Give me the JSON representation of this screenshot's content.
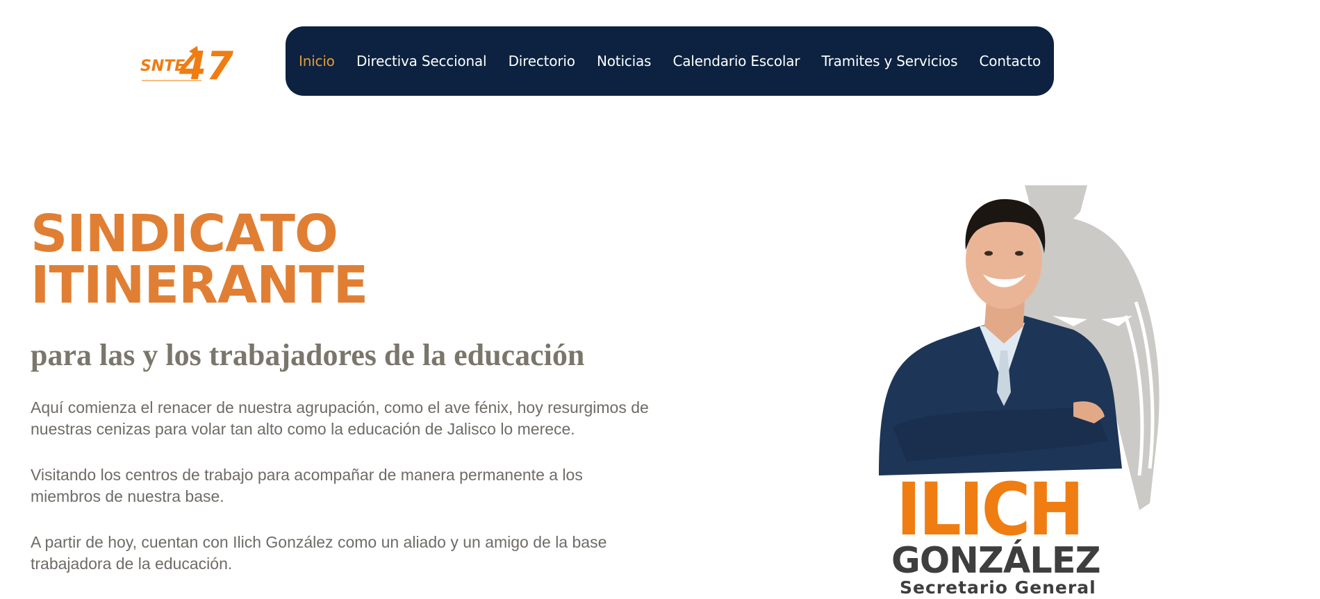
{
  "logo": {
    "text_snte": "SNTE",
    "text_number": "47",
    "icon": "snte-47-logo"
  },
  "nav": {
    "items": [
      {
        "label": "Inicio",
        "active": true
      },
      {
        "label": "Directiva Seccional",
        "active": false
      },
      {
        "label": "Directorio",
        "active": false
      },
      {
        "label": "Noticias",
        "active": false
      },
      {
        "label": "Calendario Escolar",
        "active": false
      },
      {
        "label": "Tramites y Servicios",
        "active": false
      },
      {
        "label": "Contacto",
        "active": false
      }
    ]
  },
  "hero": {
    "title": "SINDICATO ITINERANTE",
    "subtitle": "para las y los trabajadores de la educación",
    "paragraphs": [
      "Aquí comienza el renacer de nuestra agrupación, como el ave fénix, hoy resurgimos de nuestras cenizas para volar tan alto como la educación de Jalisco lo merece.",
      "Visitando los centros de trabajo para acompañar de manera permanente a los miembros de nuestra base.",
      "A partir de hoy, cuentan con Ilich González como un aliado y un amigo de la base trabajadora de la educación."
    ]
  },
  "portrait": {
    "name_first": "ILICH",
    "name_last": "GONZÁLEZ",
    "role": "Secretario General"
  },
  "colors": {
    "nav_bg": "#0c2240",
    "nav_active": "#e89a3c",
    "title_orange": "#e07f33",
    "subtitle_gray": "#7a766b",
    "text_gray": "#6f6b66",
    "brand_orange": "#ef7d12"
  }
}
